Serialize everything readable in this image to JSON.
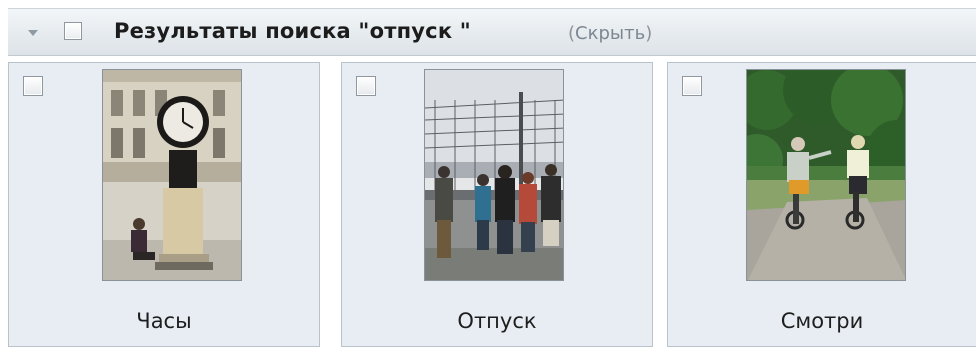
{
  "header": {
    "title": "Результаты поиска \"отпуск \"",
    "hide_open": "(",
    "hide_label": "Скрыть",
    "hide_close": ")"
  },
  "results": [
    {
      "caption": "Часы",
      "image": "clock-monument-photo"
    },
    {
      "caption": "Отпуск",
      "image": "people-at-fence-photo"
    },
    {
      "caption": "Смотри",
      "image": "cyclists-on-path-photo"
    }
  ],
  "colors": {
    "header_bg": "#e6ebef",
    "tile_bg": "#e7edf2",
    "tile_border": "#b9c3cb",
    "hide_link": "#8b929a"
  }
}
